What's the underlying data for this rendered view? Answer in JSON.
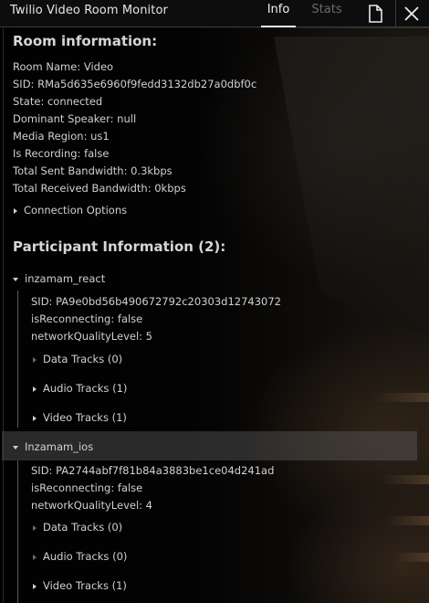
{
  "window": {
    "title": "Twilio Video Room Monitor",
    "tabs": [
      {
        "label": "Info",
        "active": true
      },
      {
        "label": "Stats",
        "active": false
      }
    ],
    "icons": [
      "copy-icon",
      "close-icon"
    ]
  },
  "room": {
    "heading": "Room information:",
    "lines": [
      "Room Name: Video",
      "SID: RMa5d635e6960f9fedd3132db27a0dbf0c",
      "State: connected",
      "Dominant Speaker: null",
      "Media Region: us1",
      "Is Recording: false",
      "Total Sent Bandwidth: 0.3kbps",
      "Total Received Bandwidth: 0kbps"
    ],
    "connection_options": "Connection Options"
  },
  "participants": {
    "heading": "Participant Information (2):",
    "items": [
      {
        "name": "inzamam_react",
        "sid": "SID: PA9e0bd56b490672792c20303d12743072",
        "reconnecting": "isReconnecting: false",
        "quality": "networkQualityLevel: 5",
        "tracks": [
          "Data Tracks (0)",
          "Audio Tracks (1)",
          "Video Tracks (1)"
        ]
      },
      {
        "name": "Inzamam_ios",
        "sid": "SID: PA2744abf7f81b84a3883be1ce04d241ad",
        "reconnecting": "isReconnecting: false",
        "quality": "networkQualityLevel: 4",
        "tracks": [
          "Data Tracks (0)",
          "Audio Tracks (0)",
          "Video Tracks (1)"
        ]
      }
    ]
  },
  "colors": {
    "panel": "#0d0d0d",
    "text": "#d0d0d0",
    "active_tab": "#f2f2f2",
    "inactive_tab": "#6a6a6a"
  }
}
